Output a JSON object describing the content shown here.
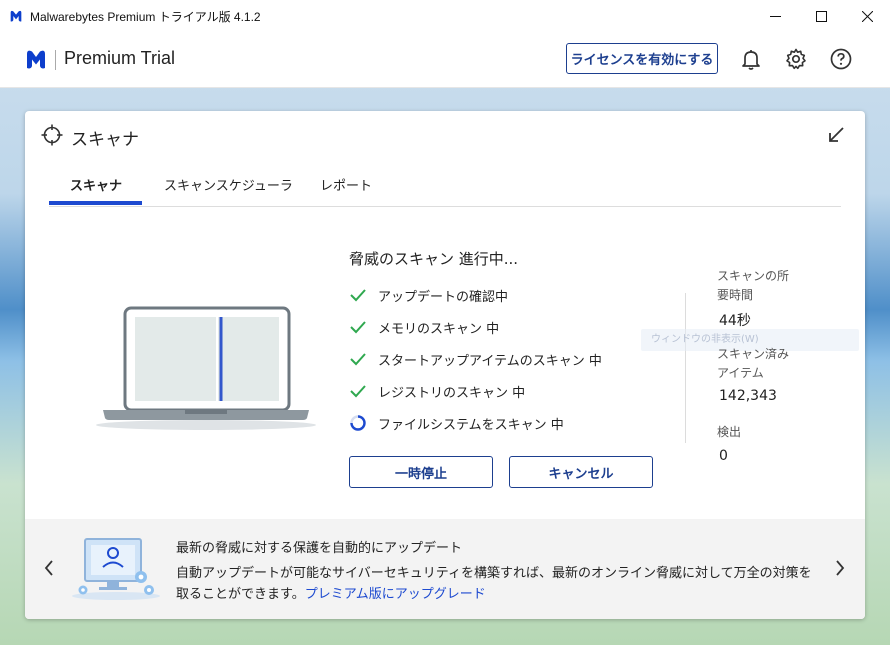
{
  "window": {
    "title": "Malwarebytes Premium トライアル版  4.1.2",
    "controls": {
      "minimize": "—",
      "maximize": "☐",
      "close": "✕"
    }
  },
  "header": {
    "brand": "Premium Trial",
    "license_button": "ライセンスを有効にする",
    "icons": [
      "bell-icon",
      "gear-icon",
      "help-icon"
    ]
  },
  "scanner": {
    "title": "スキャナ",
    "tabs": [
      {
        "label": "スキャナ",
        "active": true
      },
      {
        "label": "スキャンスケジューラ",
        "active": false
      },
      {
        "label": "レポート",
        "active": false
      }
    ],
    "progress_title": "脅威のスキャン 進行中...",
    "steps": [
      {
        "label": "アップデートの確認中",
        "status": "done"
      },
      {
        "label": "メモリのスキャン 中",
        "status": "done"
      },
      {
        "label": "スタートアップアイテムのスキャン 中",
        "status": "done"
      },
      {
        "label": "レジストリのスキャン 中",
        "status": "done"
      },
      {
        "label": "ファイルシステムをスキャン 中",
        "status": "in-progress"
      }
    ],
    "pause_button": "一時停止",
    "cancel_button": "キャンセル",
    "stats": {
      "time_label": "スキャンの所要時間",
      "time_value": "44秒",
      "items_label": "スキャン済みアイテム",
      "items_value": "142,343",
      "detections_label": "検出",
      "detections_value": "0"
    },
    "ghost_text": "ウィンドウの非表示(W)"
  },
  "promo": {
    "title": "最新の脅威に対する保護を自動的にアップデート",
    "body": "自動アップデートが可能なサイバーセキュリティを構築すれば、最新のオンライン脅威に対して万全の対策を取ることができます。",
    "link": "プレミアム版にアップグレード"
  },
  "colors": {
    "accent": "#1d4ad0",
    "button_border": "#1d3f8f",
    "check": "#2fa84f",
    "logo": "#0d3ecc"
  }
}
